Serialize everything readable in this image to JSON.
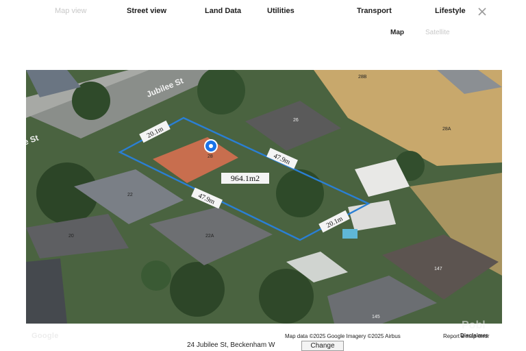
{
  "tabs": [
    {
      "label": "Map view",
      "active": false
    },
    {
      "label": "Street view",
      "active": true
    },
    {
      "label": "Land Data",
      "active": true
    },
    {
      "label": "Utilities",
      "active": true
    },
    {
      "label": "Transport",
      "active": true
    },
    {
      "label": "Lifestyle",
      "active": true
    }
  ],
  "map_type": {
    "map_label": "Map",
    "satellite_label": "Satellite",
    "selected": "Map"
  },
  "map": {
    "street_label": "Jubilee St",
    "street_label_partial": "ee St",
    "area_label": "964.1m2",
    "dimensions": {
      "top": "20.1m",
      "right": "47.9m",
      "bottom": "20.1m",
      "left": "47.9m"
    },
    "lot_numbers": [
      "28",
      "28B",
      "28A",
      "26",
      "22",
      "22A",
      "20",
      "147",
      "145"
    ],
    "boundary_color": "#2a7fd4",
    "marker_color": "#1a73e8"
  },
  "footer": {
    "map_data": "Map data ©2025 Google Imagery ©2025 Airbus",
    "report": "Report a map error",
    "disclaimer": "Disclaimer",
    "google_logo": "Google",
    "watermark": "Pobl"
  },
  "address": {
    "text": "24 Jubilee St, Beckenham W",
    "change_label": "Change"
  }
}
